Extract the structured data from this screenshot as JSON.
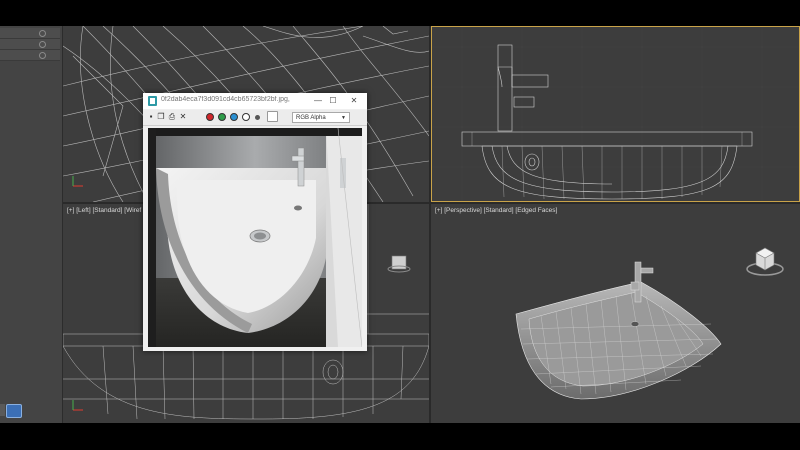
{
  "viewports": {
    "left_label": "[+] [Left] [Standard] [Wiref",
    "perspective_label": "[+] [Perspective] [Standard] [Edged Faces]"
  },
  "image_window": {
    "title": "0f2dab4eca7f3d091cd4cb65723bf2bf.jpg, Dis...",
    "min_glyph": "—",
    "max_glyph": "☐",
    "close_glyph": "✕",
    "toolbar_icons": [
      "save-icon",
      "copy-icon",
      "print-icon",
      "clear-icon"
    ],
    "channel_dots": [
      {
        "name": "red-channel",
        "color": "#d0262b"
      },
      {
        "name": "green-channel",
        "color": "#2e9c4a"
      },
      {
        "name": "blue-channel",
        "color": "#2a8fd1"
      },
      {
        "name": "mono-channel",
        "color": "#ffffff"
      },
      {
        "name": "alpha-channel",
        "color": "#555555"
      }
    ],
    "channel_value": "RGB Alpha"
  },
  "colors": {
    "viewport_bg": "#3d3d3d",
    "wire": "#cfcfcf",
    "active_border": "#c9a349"
  }
}
